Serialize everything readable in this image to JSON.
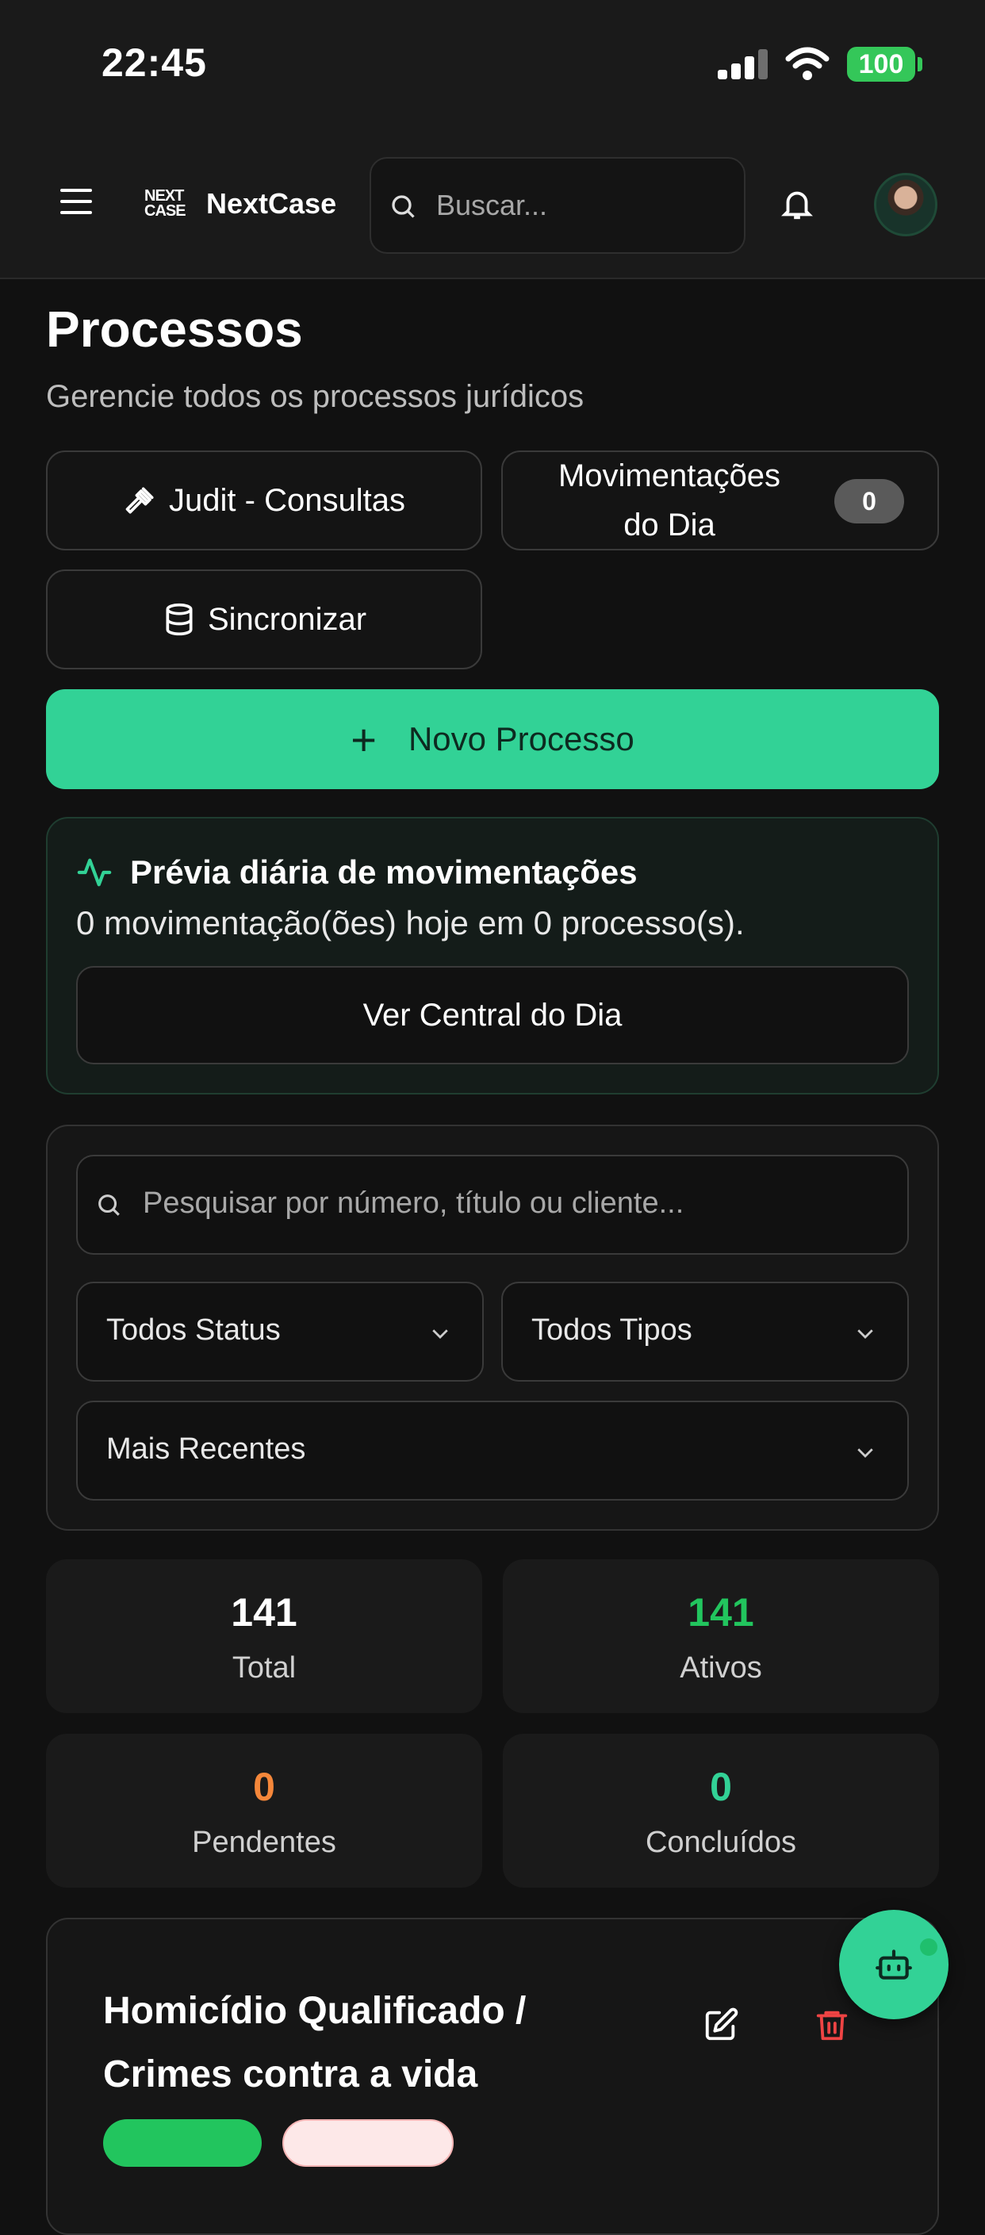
{
  "status_bar": {
    "time": "22:45",
    "battery": "100"
  },
  "header": {
    "logo_mark_line1": "NEXT",
    "logo_mark_line2": "CASE",
    "app_name": "NextCase",
    "search_placeholder": "Buscar..."
  },
  "page": {
    "title": "Processos",
    "subtitle": "Gerencie todos os processos jurídicos"
  },
  "actions": {
    "judit_label": "Judit - Consultas",
    "movements_label_line1": "Movimentações",
    "movements_label_line2": "do Dia",
    "movements_count": "0",
    "sync_label": "Sincronizar",
    "new_process_label": "Novo Processo"
  },
  "preview": {
    "title": "Prévia diária de movimentações",
    "summary": "0 movimentação(ões) hoje em 0 processo(s).",
    "button_label": "Ver Central do Dia"
  },
  "filters": {
    "search_placeholder": "Pesquisar por número, título ou cliente...",
    "status_selected": "Todos Status",
    "type_selected": "Todos Tipos",
    "sort_selected": "Mais Recentes"
  },
  "stats": [
    {
      "value": "141",
      "label": "Total",
      "color": "#ffffff"
    },
    {
      "value": "141",
      "label": "Ativos",
      "color": "#22c55e"
    },
    {
      "value": "0",
      "label": "Pendentes",
      "color": "#f5873a"
    },
    {
      "value": "0",
      "label": "Concluídos",
      "color": "#32d296"
    }
  ],
  "process_card": {
    "title_line1": "Homicídio Qualificado /",
    "title_line2": "Crimes contra a vida"
  },
  "colors": {
    "accent": "#32d296",
    "danger": "#ef4444",
    "background": "#111111"
  }
}
